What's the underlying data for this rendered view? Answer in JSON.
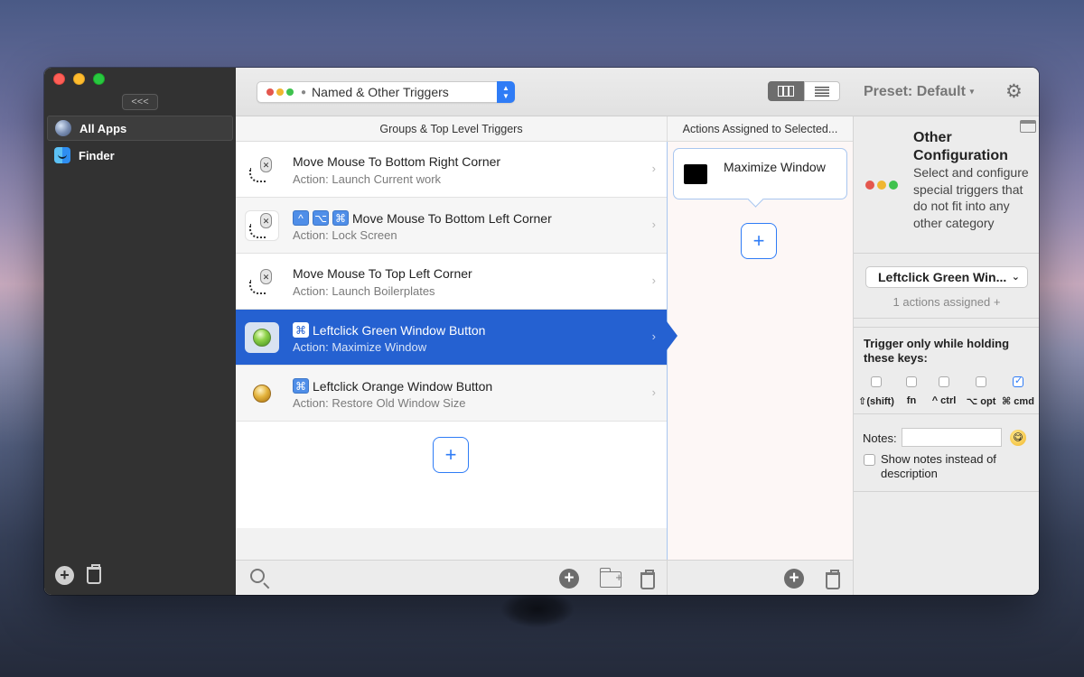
{
  "sidebar": {
    "collapse_label": "<<<",
    "apps": [
      {
        "label": "All Apps",
        "icon": "globe-icon",
        "selected": true
      },
      {
        "label": "Finder",
        "icon": "finder-icon",
        "selected": false
      }
    ]
  },
  "toolbar": {
    "trigger_select": "Named & Other Triggers",
    "preset_label": "Preset: Default",
    "preset_caret": "▾"
  },
  "columns": {
    "groups_header": "Groups & Top Level Triggers",
    "actions_header": "Actions Assigned to Selected..."
  },
  "triggers": [
    {
      "title": "Move Mouse To Bottom Right Corner",
      "action": "Action: Launch Current work",
      "keys": [],
      "icon": "mouse-path-icon"
    },
    {
      "title": "Move Mouse To Bottom Left Corner",
      "action": "Action: Lock Screen",
      "keys": [
        "^",
        "⌥",
        "⌘"
      ],
      "icon": "mouse-path-icon"
    },
    {
      "title": "Move Mouse To Top Left Corner",
      "action": "Action: Launch Boilerplates",
      "keys": [],
      "icon": "mouse-path-icon"
    },
    {
      "title": "Leftclick Green Window Button",
      "action": "Action: Maximize Window",
      "keys": [
        "⌘"
      ],
      "icon": "green-button-icon",
      "selected": true
    },
    {
      "title": "Leftclick Orange Window Button",
      "action": "Action: Restore Old Window Size",
      "keys": [
        "⌘"
      ],
      "icon": "orange-button-icon"
    }
  ],
  "actions": [
    {
      "label": "Maximize Window"
    }
  ],
  "config": {
    "title": "Other Configuration",
    "description": "Select and configure special triggers that do not  fit into any other category",
    "trigger_value": "Leftclick Green Win...",
    "assigned": "1 actions assigned +",
    "keys_title": "Trigger only while holding these keys:",
    "keys": [
      {
        "label": "⇧(shift)",
        "checked": false
      },
      {
        "label": "fn",
        "checked": false
      },
      {
        "label": "^ ctrl",
        "checked": false
      },
      {
        "label": "⌥ opt",
        "checked": false
      },
      {
        "label": "⌘ cmd",
        "checked": true
      }
    ],
    "notes_label": "Notes:",
    "notes_value": "",
    "show_notes_label": "Show notes instead of description"
  },
  "icons": {
    "add": "+",
    "chevron": "›",
    "gear": "⚙",
    "emoji": "😋"
  },
  "colors": {
    "accent": "#2f7cf6",
    "selection": "#2561d1",
    "sidebar": "#323232"
  }
}
